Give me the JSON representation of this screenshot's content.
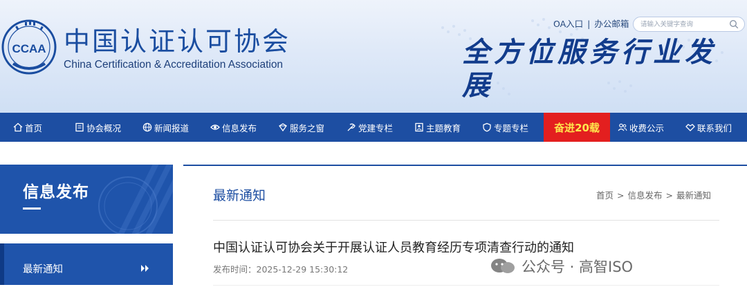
{
  "header": {
    "logo_seal_text": "CCAA",
    "logo_cn": "中国认证认可协会",
    "logo_en": "China Certification & Accreditation Association",
    "slogan": "全方位服务行业发展",
    "links": {
      "oa": "OA入口",
      "mail": "办公邮箱"
    },
    "search": {
      "placeholder": "请输入关键字查询",
      "icon": "search-icon"
    }
  },
  "nav": {
    "items": [
      {
        "label": "首页",
        "icon": "home-icon"
      },
      {
        "label": "协会概况",
        "icon": "document-icon"
      },
      {
        "label": "新闻报道",
        "icon": "globe-icon"
      },
      {
        "label": "信息发布",
        "icon": "eye-icon"
      },
      {
        "label": "服务之窗",
        "icon": "service-icon"
      },
      {
        "label": "党建专栏",
        "icon": "party-icon"
      },
      {
        "label": "主题教育",
        "icon": "person-badge-icon"
      },
      {
        "label": "专题专栏",
        "icon": "shield-icon"
      },
      {
        "label": "奋进20载",
        "icon": ""
      },
      {
        "label": "收费公示",
        "icon": "users-icon"
      },
      {
        "label": "联系我们",
        "icon": "handshake-icon"
      }
    ],
    "colors": {
      "bar": "#1d4ea2",
      "special_bg": "#e31f1f",
      "special_text": "#ffe64d"
    }
  },
  "sidebar": {
    "title": "信息发布",
    "menu": [
      {
        "label": "最新通知",
        "icon": "double-chevron-right-icon"
      }
    ]
  },
  "content": {
    "title": "最新通知",
    "breadcrumb": [
      "首页",
      "信息发布",
      "最新通知"
    ],
    "article": {
      "title": "中国认证认可协会关于开展认证人员教育经历专项清查行动的通知",
      "publish_label": "发布时间：2025-12-29 15:30:12"
    }
  },
  "watermark": {
    "text": "公众号 · 高智ISO"
  }
}
